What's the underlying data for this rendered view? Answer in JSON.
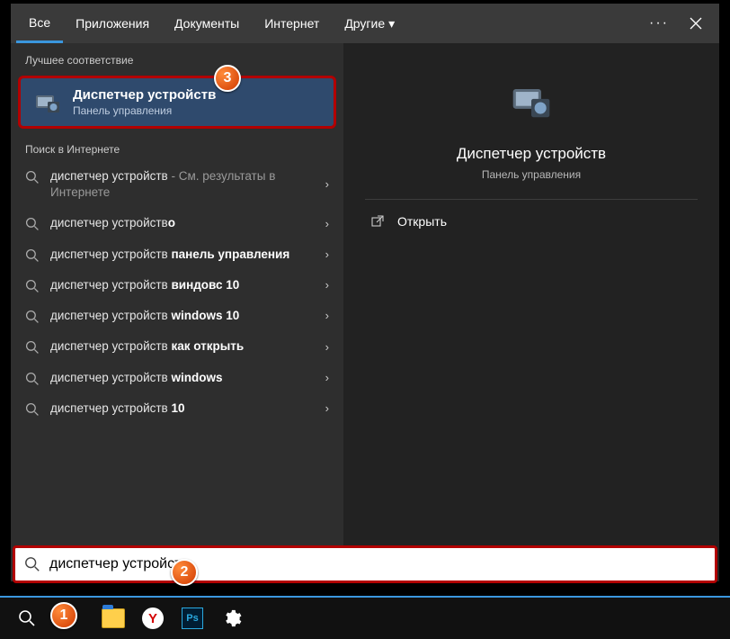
{
  "tabs": {
    "all": "Все",
    "apps": "Приложения",
    "docs": "Документы",
    "web": "Интернет",
    "more": "Другие"
  },
  "sections": {
    "best": "Лучшее соответствие",
    "web": "Поиск в Интернете"
  },
  "bestMatch": {
    "title": "Диспетчер устройств",
    "subtitle": "Панель управления"
  },
  "suggestions": [
    {
      "prefix": "диспетчер устройств",
      "suffix": " - См. результаты в Интернете",
      "suffixMuted": true
    },
    {
      "prefix": "диспетчер устройств",
      "bold": "о"
    },
    {
      "prefix": "диспетчер устройств ",
      "bold": "панель управления"
    },
    {
      "prefix": "диспетчер устройств ",
      "bold": "виндовс 10"
    },
    {
      "prefix": "диспетчер устройств ",
      "bold": "windows 10"
    },
    {
      "prefix": "диспетчер устройств ",
      "bold": "как открыть"
    },
    {
      "prefix": "диспетчер устройств ",
      "bold": "windows"
    },
    {
      "prefix": "диспетчер устройств ",
      "bold": "10"
    }
  ],
  "preview": {
    "title": "Диспетчер устройств",
    "subtitle": "Панель управления",
    "open": "Открыть"
  },
  "search": {
    "value": "диспетчер устройств"
  },
  "badges": {
    "b1": "1",
    "b2": "2",
    "b3": "3"
  }
}
